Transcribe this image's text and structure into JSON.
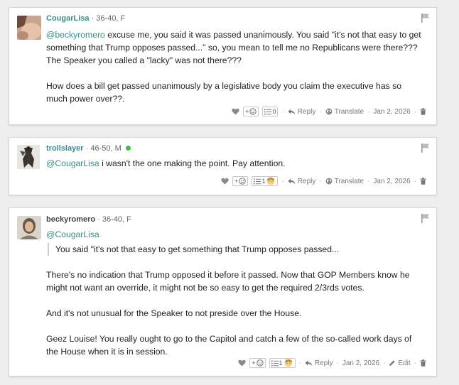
{
  "comments": [
    {
      "username": "CougarLisa",
      "meta": "· 36-40, F",
      "online": false,
      "paragraphs": [
        [
          {
            "t": "@beckyromero",
            "m": true
          },
          {
            "t": " excuse me, you said it was passed unanimously. You said \"it's not that easy to get something that Trump opposes passed...\" so, you mean to tell me no Republicans were there??? The Speaker you called a \"lacky\" was not there???"
          }
        ],
        [
          {
            "t": "How does a bill get passed unanimously by a legislative body you claim the executive has so much power over??."
          }
        ]
      ],
      "actions": {
        "reaction_plus": "+",
        "list_count": "0",
        "show_avatar": false,
        "reply": "Reply",
        "translate": "Translate",
        "date": "Jan 2, 2026"
      }
    },
    {
      "username": "trollslayer",
      "meta": "· 46-50, M",
      "online": true,
      "paragraphs": [
        [
          {
            "t": "@CougarLisa",
            "m": true
          },
          {
            "t": " i wasn't the one making the point. Pay attention."
          }
        ]
      ],
      "actions": {
        "reaction_plus": "+",
        "list_count": "1",
        "show_avatar": true,
        "reply": "Reply",
        "translate": "Translate",
        "date": "Jan 2, 2026"
      }
    },
    {
      "username": "beckyromero",
      "meta": "· 36-40, F",
      "online": false,
      "mention_line": "@CougarLisa",
      "quote": "You said \"it's not that easy to get something that Trump opposes passed...",
      "paragraphs": [
        [
          {
            "t": "There's no indication that Trump opposed it before it passed. Now that GOP Members know he might not want an override, it might not be so easy to get the required 2/3rds votes."
          }
        ],
        [
          {
            "t": "And it's not unusual for the Speaker to not preside over the House."
          }
        ],
        [
          {
            "t": "Geez Louise! You really ought to go to the Capitol and catch a few of the so-called work days of the House when it is in session."
          }
        ]
      ],
      "actions": {
        "reaction_plus": "+",
        "list_count": "1",
        "show_avatar": true,
        "reply": "Reply",
        "date": "Jan 2, 2026",
        "edit": "Edit"
      }
    }
  ],
  "icons": {
    "flag": "flag-icon",
    "heart": "heart-icon",
    "smiley": "smiley-icon",
    "list": "list-icon",
    "reply": "reply-arrow-icon",
    "globe": "globe-icon",
    "pencil": "pencil-icon",
    "trash": "trash-icon"
  },
  "colors": {
    "mention": "#3b8b8a",
    "online": "#3fbf3f",
    "background": "#eeeeee"
  }
}
